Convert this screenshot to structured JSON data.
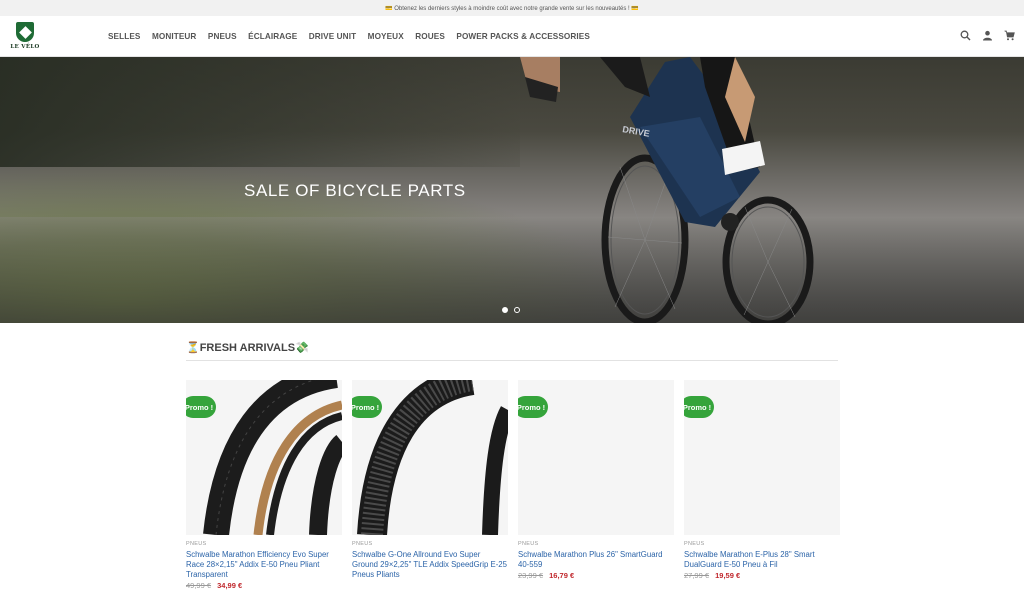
{
  "announcement": "💳 Obtenez les derniers styles à moindre coût avec notre grande vente sur les nouveautés ! 💳",
  "logo": {
    "text": "LE VÉLO"
  },
  "nav": [
    "SELLES",
    "MONITEUR",
    "PNEUS",
    "ÉCLAIRAGE",
    "DRIVE UNIT",
    "MOYEUX",
    "ROUES",
    "POWER PACKS & ACCESSORIES"
  ],
  "header_icons": [
    "search-icon",
    "user-icon",
    "cart-icon"
  ],
  "hero": {
    "title": "SALE OF BICYCLE PARTS",
    "slides": 2,
    "active_slide": 1
  },
  "section": {
    "title": "⏳FRESH ARRIVALS💸"
  },
  "products": [
    {
      "badge": "Promo !",
      "category": "PNEUS",
      "name": "Schwalbe Marathon Efficiency Evo Super Race 28×2,15\" Addix E-50 Pneu Pliant Transparent",
      "old_price": "49,99 €",
      "price": "34,99 €"
    },
    {
      "badge": "Promo !",
      "category": "PNEUS",
      "name": "Schwalbe G-One Allround Evo Super Ground 29×2,25\" TLE Addix SpeedGrip E-25 Pneus Pliants",
      "old_price": "",
      "price": ""
    },
    {
      "badge": "Promo !",
      "category": "PNEUS",
      "name": "Schwalbe Marathon Plus 26\" SmartGuard 40-559",
      "old_price": "23,99 €",
      "price": "16,79 €"
    },
    {
      "badge": "Promo !",
      "category": "PNEUS",
      "name": "Schwalbe Marathon E-Plus 28\" Smart DualGuard E-50 Pneu à Fil",
      "old_price": "27,99 €",
      "price": "19,59 €"
    }
  ],
  "colors": {
    "promo_badge": "#35a43b",
    "product_link": "#2c64a8",
    "sale_price": "#c0282d",
    "logo_green": "#1e6b35"
  }
}
